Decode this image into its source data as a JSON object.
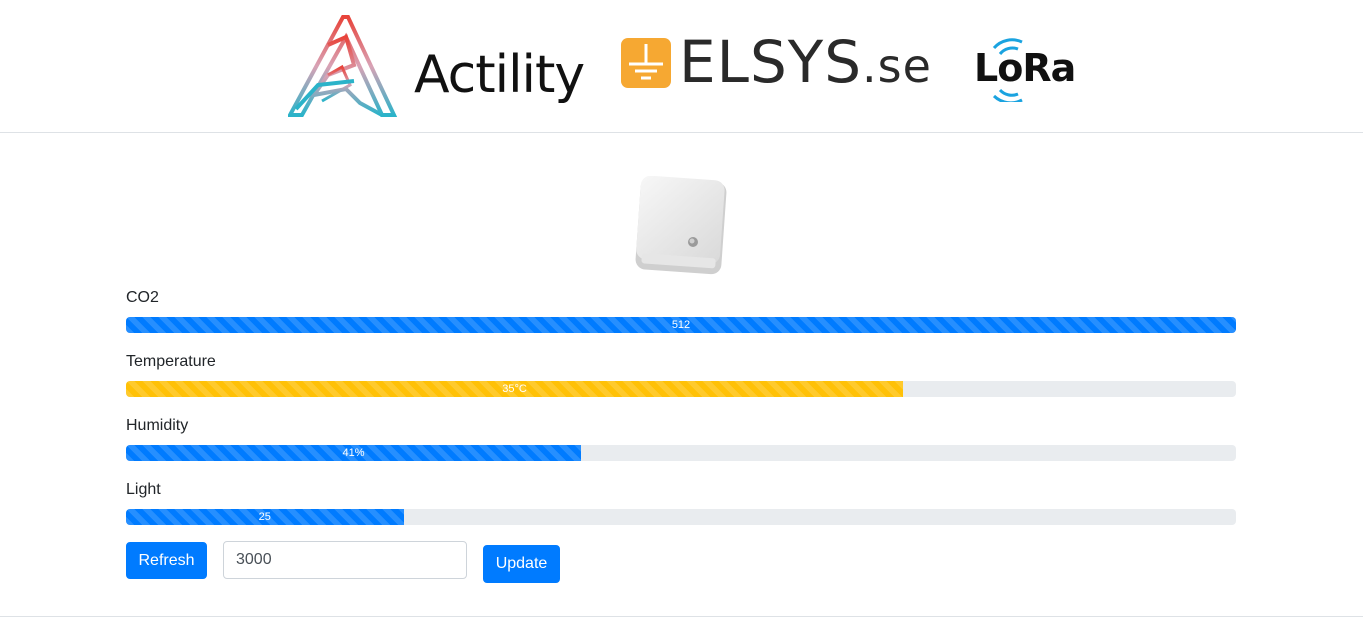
{
  "header": {
    "logos": [
      {
        "name": "Actility",
        "text": "Actility",
        "colors": [
          "#e8433a",
          "#2bb3c9"
        ]
      },
      {
        "name": "ELSYS.se",
        "text_main": "ELSYS",
        "text_suffix": ".se",
        "mark_color": "#f6a832"
      },
      {
        "name": "LoRa",
        "text": "LoRa",
        "wave_color": "#1aa3e0"
      }
    ]
  },
  "device": {
    "image": "elsys-sensor-device"
  },
  "metrics": [
    {
      "label": "CO2",
      "bar_text": "512",
      "fraction": 1.0,
      "color": "#007bff"
    },
    {
      "label": "Temperature",
      "bar_text": "35°C",
      "fraction": 0.7,
      "color": "#ffc107"
    },
    {
      "label": "Humidity",
      "bar_text": "41%",
      "fraction": 0.41,
      "color": "#007bff"
    },
    {
      "label": "Light",
      "bar_text": "25",
      "fraction": 0.25,
      "color": "#007bff"
    }
  ],
  "controls": {
    "refresh_label": "Refresh",
    "interval_value": "3000",
    "update_label": "Update"
  }
}
